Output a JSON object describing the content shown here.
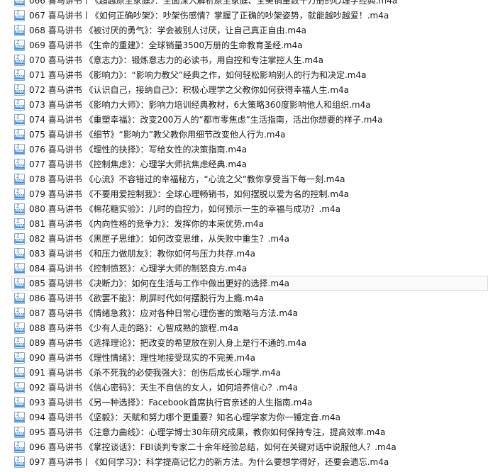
{
  "icon": {
    "name": "m4a-file-icon",
    "label": "M4A"
  },
  "selected_index": 19,
  "files": [
    "066 喜马讲书丨《超越原生家庭》：全面深入解析原生家庭、全美销量数十万册的心理学经典.m4a",
    "067 喜马讲书丨《如何正确吵架》：吵架伤感情？掌握了正确的吵架姿势，就能越吵越爱！.m4a",
    "068 喜马讲书 《被讨厌的勇气》：学会被别人讨厌，让自己真正自由.m4a",
    "069 喜马讲书 《生命的重建》：全球销量3500万册的生命教育圣经.m4a",
    "070 喜马讲书 《意志力》：锻炼意志力的必读书，用自控和专注掌控人生.m4a",
    "071 喜马讲书 《影响力》：“影响力教父”经典之作，如何轻松影响别人的行为和决定.m4a",
    "072 喜马讲书 《认识自己，接纳自己》：积极心理学之父教你如何获得幸福人生.m4a",
    "073 喜马讲书 《影响力大师》：影响力培训经典教材，6大策略360度影响他人和组织.m4a",
    "074 喜马讲书 《重塑幸福》：改变200万人的“都市零焦虑”生活指南，活出你想要的样子.m4a",
    "075 喜马讲书 《细节》“影响力”教父教你用细节改变他人行为.m4a",
    "076 喜马讲书 《理性的抉择》：写给女性的决策指南.m4a",
    "077 喜马讲书 《控制焦虑》：心理学大师抗焦虑经典.m4a",
    "078 喜马讲书 《心流》不容错过的幸福秘方，“心流之父”教你享受当下每一刻.m4a",
    "079 喜马讲书 《不要用爱控制我》：全球心理畅销书，如何摆脱以爱为名的控制.m4a",
    "080 喜马讲书 《棉花糖实验》：儿时的自控力，如何预示一生的幸福与成功？.m4a",
    "081 喜马讲书 《内向性格的竞争力》：发挥你的本来优势.m4a",
    "082 喜马讲书 《黑匣子思维》：如何改变思维，从失败中重生？.m4a",
    "083 喜马讲书 《和压力做朋友》：教你如何与压力共存.m4a",
    "084 喜马讲书 《控制愤怒》：心理学大师的制怒良方.m4a",
    "085 喜马讲书 《决断力》：如何在生活与工作中做出更好的选择.m4a",
    "086 喜马讲书 《欲罢不能》：刷屏时代如何摆脱行为上瘾.m4a",
    "087 喜马讲书 《情绪急救》：应对各种日常心理伤害的策略与方法.m4a",
    "088 喜马讲书 《少有人走的路》：心智成熟的旅程.m4a",
    "089 喜马讲书 《选择理论》：把改变的希望放在别人身上是行不通的.m4a",
    "090 喜马讲书 《理性情绪》：理性地接受现实的不完美.m4a",
    "091 喜马讲书 《杀不死我的必使我强大》：创伤后成长心理学.m4a",
    "092 喜马讲书 《信心密码》：天生不自信的女人，如何培养信心？.m4a",
    "093 喜马讲书 《另一种选择》：Facebook首席执行官亲述的人生指南.m4a",
    "094 喜马讲书 《坚毅》：天赋和努力哪个更重要？知名心理学家为你一锤定音.m4a",
    "095 喜马讲书 《注意力曲线》：心理学博士30年研究成果，教你如何保持专注，提高效率.m4a",
    "096 喜马讲书 《掌控谈话》：FBI谈判专家二十余年经验总结，如何在关键对话中说服他人？.m4a",
    "097 喜马讲书丨《如何学习》：科学提高记忆力的新方法。为什么要想学得好，还要会遗忘.m4a"
  ]
}
